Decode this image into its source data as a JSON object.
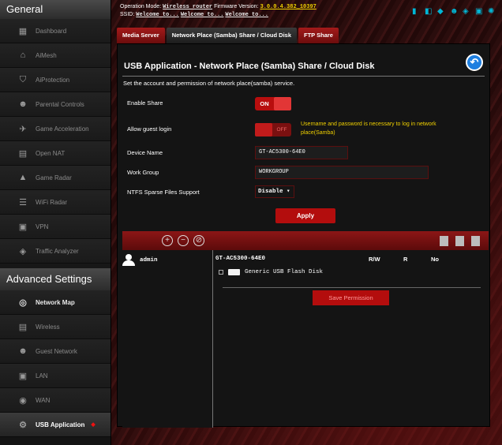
{
  "sidebar": {
    "general_title": "General",
    "general_items": [
      {
        "label": "Dashboard",
        "icon": "dashboard-icon",
        "glyph": "▦"
      },
      {
        "label": "AiMesh",
        "icon": "mesh-icon",
        "glyph": "⌂"
      },
      {
        "label": "AiProtection",
        "icon": "shield-lock-icon",
        "glyph": "⛉"
      },
      {
        "label": "Parental Controls",
        "icon": "family-icon",
        "glyph": "☻"
      },
      {
        "label": "Game Acceleration",
        "icon": "rocket-icon",
        "glyph": "✈"
      },
      {
        "label": "Open NAT",
        "icon": "nat-icon",
        "glyph": "▤"
      },
      {
        "label": "Game Radar",
        "icon": "radar-icon",
        "glyph": "▲"
      },
      {
        "label": "WiFi Radar",
        "icon": "wifi-radar-icon",
        "glyph": "☰"
      },
      {
        "label": "VPN",
        "icon": "vpn-icon",
        "glyph": "▣"
      },
      {
        "label": "Traffic Analyzer",
        "icon": "traffic-icon",
        "glyph": "◈"
      }
    ],
    "advanced_title": "Advanced Settings",
    "advanced_items": [
      {
        "label": "Network Map",
        "icon": "network-map-icon",
        "glyph": "◎"
      },
      {
        "label": "Wireless",
        "icon": "wireless-icon",
        "glyph": "▤"
      },
      {
        "label": "Guest Network",
        "icon": "guest-icon",
        "glyph": "☻"
      },
      {
        "label": "LAN",
        "icon": "lan-icon",
        "glyph": "▣"
      },
      {
        "label": "WAN",
        "icon": "globe-icon",
        "glyph": "◉"
      },
      {
        "label": "USB Application",
        "icon": "usb-icon",
        "glyph": "⚙"
      }
    ]
  },
  "header": {
    "op_mode_label": "Operation Mode:",
    "op_mode_value": "Wireless router",
    "fw_label": "Firmware Version:",
    "fw_value": "3.0.0.4.382_10397",
    "ssid_label": "SSID:",
    "ssid_1": "Welcome to...",
    "ssid_2": "Welcome to...",
    "ssid_3": "Welcome to..."
  },
  "tabs": [
    "Media Server",
    "Network Place (Samba) Share / Cloud Disk",
    "FTP Share"
  ],
  "page": {
    "title": "USB Application - Network Place (Samba) Share / Cloud Disk",
    "description": "Set the account and permission of network place(samba) service.",
    "enable_share_label": "Enable Share",
    "enable_share_value": "ON",
    "guest_login_label": "Allow guest login",
    "guest_login_value": "OFF",
    "guest_note": "Username and password is necessary to log in network place(Samba)",
    "device_name_label": "Device Name",
    "device_name_value": "GT-AC5300-64E0",
    "work_group_label": "Work Group",
    "work_group_value": "WORKGROUP",
    "ntfs_label": "NTFS Sparse Files Support",
    "ntfs_value": "Disable ▾",
    "apply_label": "Apply"
  },
  "permissions": {
    "user": "admin",
    "device": "GT-AC5300-64E0",
    "col_rw": "R/W",
    "col_r": "R",
    "col_no": "No",
    "disk": "Generic USB Flash Disk",
    "save_label": "Save Permission"
  }
}
